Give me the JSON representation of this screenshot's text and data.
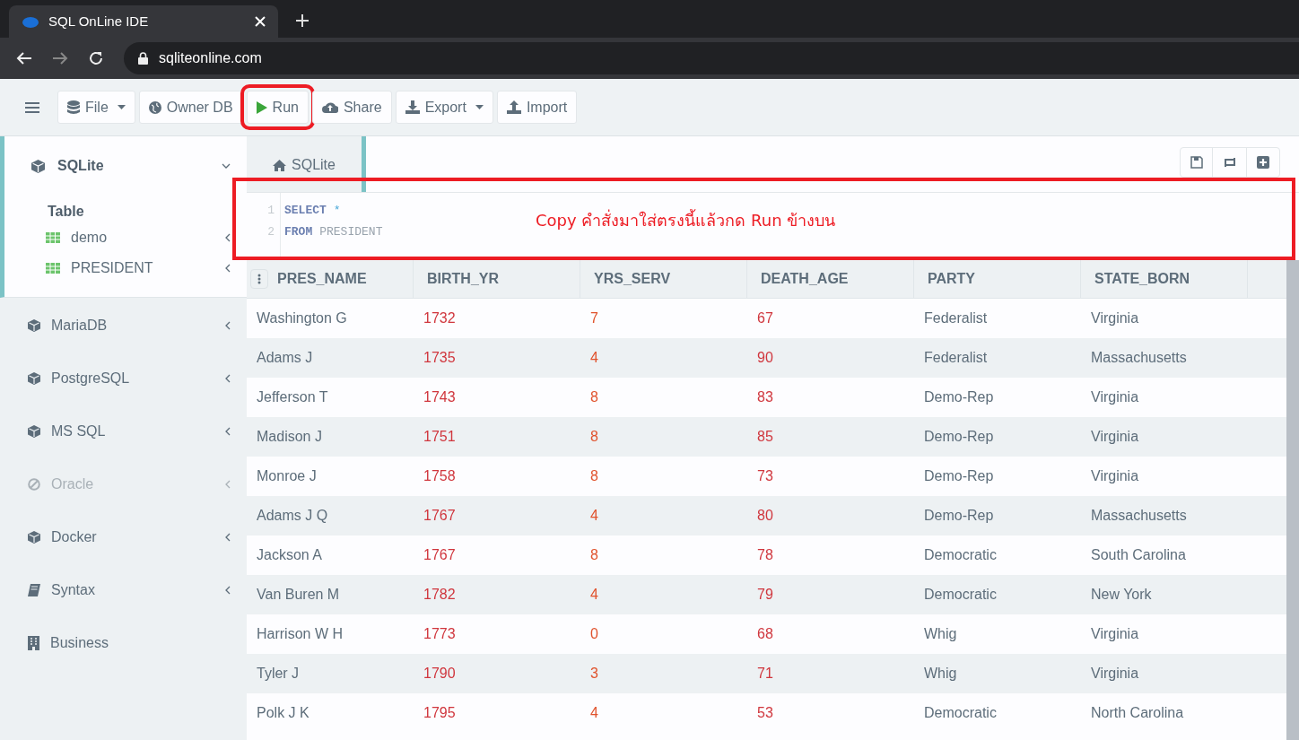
{
  "browser": {
    "tab_title": "SQL OnLine IDE",
    "address": "sqliteonline.com"
  },
  "toolbar": [
    {
      "label": "File",
      "dropdown": true,
      "highlighted": false
    },
    {
      "label": "Owner DB",
      "dropdown": false,
      "highlighted": false
    },
    {
      "label": "Run",
      "dropdown": false,
      "highlighted": true
    },
    {
      "label": "Share",
      "dropdown": false,
      "highlighted": false
    },
    {
      "label": "Export",
      "dropdown": true,
      "highlighted": false
    },
    {
      "label": "Import",
      "dropdown": false,
      "highlighted": false
    }
  ],
  "sidebar": {
    "active": {
      "label": "SQLite",
      "expanded": true,
      "group_label": "Table",
      "tables": [
        "demo",
        "PRESIDENT"
      ]
    },
    "items": [
      {
        "label": "MariaDB",
        "disabled": false
      },
      {
        "label": "PostgreSQL",
        "disabled": false
      },
      {
        "label": "MS SQL",
        "disabled": false
      },
      {
        "label": "Oracle",
        "disabled": true
      },
      {
        "label": "Docker",
        "disabled": false
      },
      {
        "label": "Syntax",
        "disabled": false
      },
      {
        "label": "Business",
        "disabled": false
      }
    ]
  },
  "editor": {
    "tab": "SQLite",
    "lines": [
      {
        "number": "1",
        "keyword": "SELECT",
        "rest": "*"
      },
      {
        "number": "2",
        "keyword": "FROM",
        "rest": "PRESIDENT"
      }
    ]
  },
  "annotation": {
    "text": "Copy คำสั่งมาใส่ตรงนี้แล้วกด Run ข้างบน"
  },
  "table": {
    "columns": [
      "PRES_NAME",
      "BIRTH_YR",
      "YRS_SERV",
      "DEATH_AGE",
      "PARTY",
      "STATE_BORN"
    ],
    "rows": [
      [
        "Washington G",
        "1732",
        "7",
        "67",
        "Federalist",
        "Virginia"
      ],
      [
        "Adams J",
        "1735",
        "4",
        "90",
        "Federalist",
        "Massachusetts"
      ],
      [
        "Jefferson T",
        "1743",
        "8",
        "83",
        "Demo-Rep",
        "Virginia"
      ],
      [
        "Madison J",
        "1751",
        "8",
        "85",
        "Demo-Rep",
        "Virginia"
      ],
      [
        "Monroe J",
        "1758",
        "8",
        "73",
        "Demo-Rep",
        "Virginia"
      ],
      [
        "Adams J Q",
        "1767",
        "4",
        "80",
        "Demo-Rep",
        "Massachusetts"
      ],
      [
        "Jackson A",
        "1767",
        "8",
        "78",
        "Democratic",
        "South Carolina"
      ],
      [
        "Van Buren M",
        "1782",
        "4",
        "79",
        "Democratic",
        "New York"
      ],
      [
        "Harrison W H",
        "1773",
        "0",
        "68",
        "Whig",
        "Virginia"
      ],
      [
        "Tyler J",
        "1790",
        "3",
        "71",
        "Whig",
        "Virginia"
      ],
      [
        "Polk J K",
        "1795",
        "4",
        "53",
        "Democratic",
        "North Carolina"
      ]
    ]
  }
}
